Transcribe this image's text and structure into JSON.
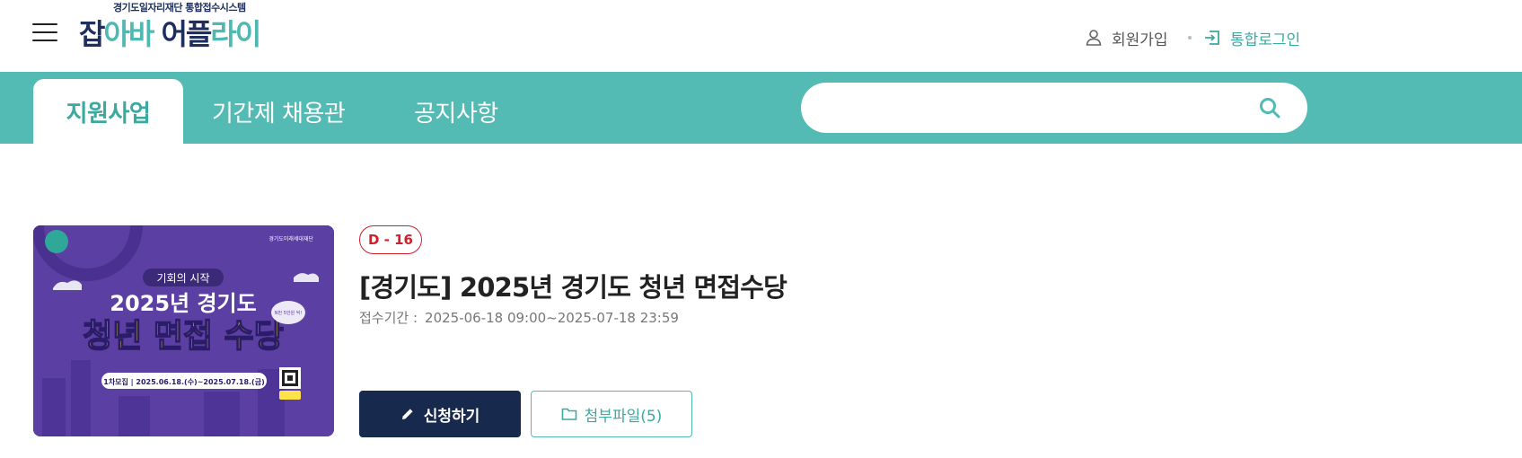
{
  "header": {
    "menu_icon": "hamburger-menu-icon",
    "logo": {
      "subtitle": "경기도일자리재단 통합접수시스템",
      "part1": "잡",
      "part2": "아바 ",
      "part3": "어플",
      "part4": "라이"
    },
    "join_label": "회원가입",
    "join_icon": "person-icon",
    "login_label": "통합로그인",
    "login_icon": "login-arrow-icon"
  },
  "nav": {
    "tabs": [
      {
        "label": "지원사업",
        "active": true
      },
      {
        "label": "기간제 채용관",
        "active": false
      },
      {
        "label": "공지사항",
        "active": false
      }
    ],
    "search": {
      "placeholder": "",
      "value": "",
      "icon": "search-icon"
    }
  },
  "program": {
    "dday": "D - 16",
    "title": "[경기도] 2025년 경기도 청년 면접수당",
    "period_label": "접수기간 :",
    "period_value": "2025-06-18 09:00~2025-07-18 23:59",
    "apply_label": "신청하기",
    "apply_icon": "pencil-icon",
    "files_label": "첨부파일(5)",
    "files_icon": "folder-icon",
    "thumbnail": {
      "org": "경기도미래세대재단",
      "kicker": "기회의 시작",
      "headline1": "2025년 경기도",
      "headline2": "청년 면접 수당",
      "bubble": "N번 5만원 씩!",
      "period": "1차모집 | 2025.06.18.(수)~2025.07.18.(금)",
      "colors": {
        "bg": "#5b3fa3",
        "yellow": "#ffe14a"
      }
    }
  },
  "colors": {
    "teal": "#53bbb3",
    "navy": "#17294d",
    "red": "#d0202a"
  }
}
